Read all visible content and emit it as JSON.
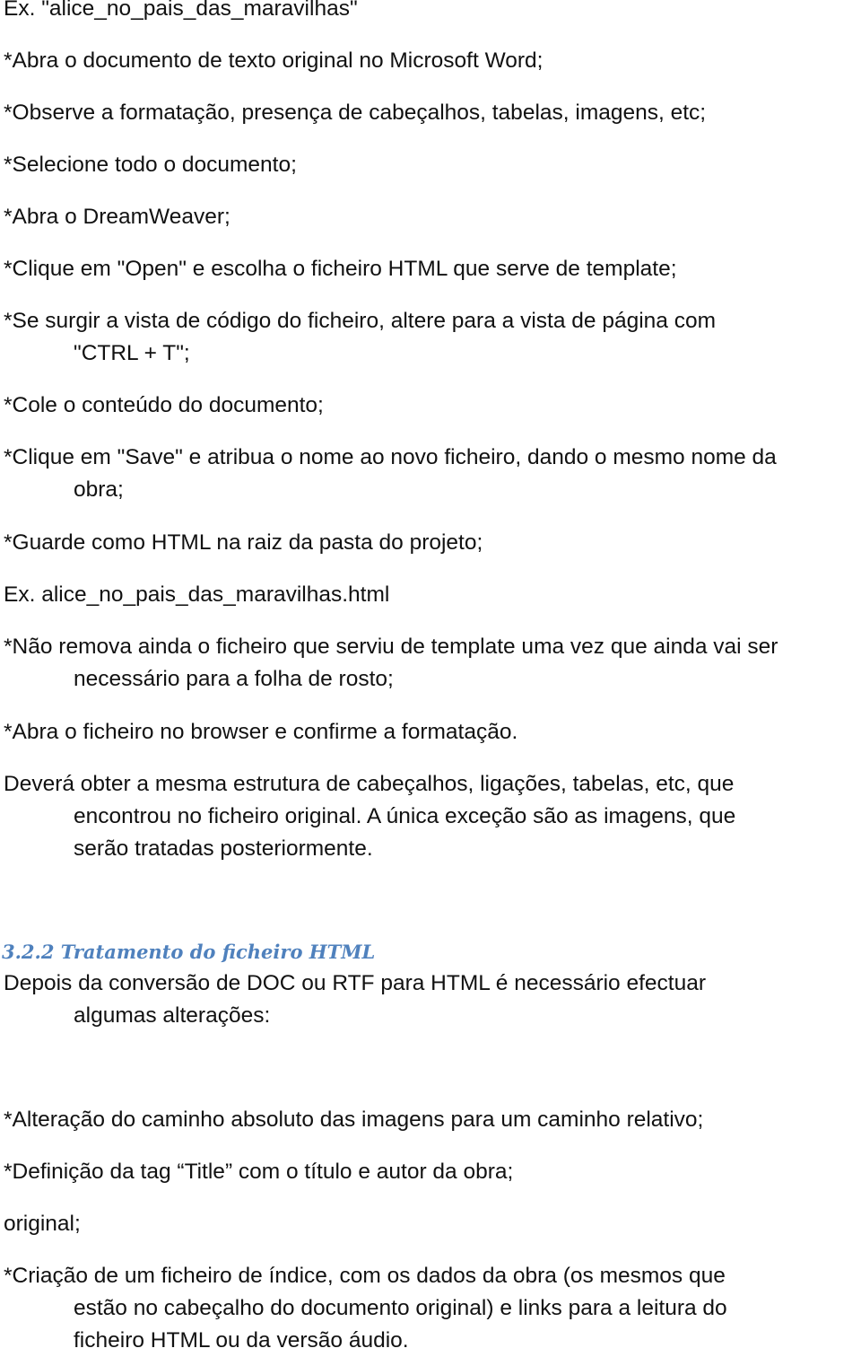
{
  "document": {
    "lines": [
      {
        "text": "Ex. \"alice_no_pais_das_maravilhas\""
      },
      {
        "text": "*Abra o documento de texto original no Microsoft Word;"
      },
      {
        "text": "*Observe a formatação, presença de cabeçalhos, tabelas, imagens, etc;"
      },
      {
        "text": "*Selecione todo o documento;"
      },
      {
        "text": "*Abra o DreamWeaver;"
      },
      {
        "text": "*Clique em \"Open\" e escolha o ficheiro HTML que serve de template;"
      },
      {
        "text": "*Se surgir a vista de código do ficheiro, altere para a vista de página com",
        "cont": "\"CTRL + T\";"
      },
      {
        "text": "*Cole o conteúdo do documento;"
      },
      {
        "text": "*Clique em \"Save\" e atribua o nome ao novo ficheiro, dando o mesmo nome da",
        "cont": "obra;"
      },
      {
        "text": "*Guarde como HTML na raiz da pasta do projeto;"
      },
      {
        "text": "Ex. alice_no_pais_das_maravilhas.html"
      },
      {
        "text": "*Não remova ainda o ficheiro que serviu de template uma vez que ainda vai ser",
        "cont": "necessário para a folha de rosto;"
      },
      {
        "text": "*Abra o ficheiro no browser e confirme a formatação."
      },
      {
        "text": "Deverá obter a mesma estrutura de cabeçalhos, ligações, tabelas, etc, que",
        "cont": "encontrou no ficheiro original. A única exceção são as imagens, que",
        "cont2": "serão tratadas posteriormente."
      }
    ],
    "heading": "3.2.2 Tratamento do ficheiro HTML",
    "heading_color": "#4f81bd",
    "section_lines": [
      {
        "text": "Depois da conversão de DOC ou RTF para HTML é necessário efectuar",
        "cont": "algumas alterações:"
      },
      {
        "text": "*Alteração do caminho absoluto das imagens para um caminho relativo;"
      },
      {
        "text": "*Definição da tag “Title” com o título e autor da obra;"
      },
      {
        "text": "original;"
      },
      {
        "text": "*Criação de um ficheiro de índice, com os dados da obra (os mesmos que",
        "cont": "estão no cabeçalho do documento original) e links para a leitura do",
        "cont2": "ficheiro HTML ou da versão áudio."
      }
    ]
  }
}
